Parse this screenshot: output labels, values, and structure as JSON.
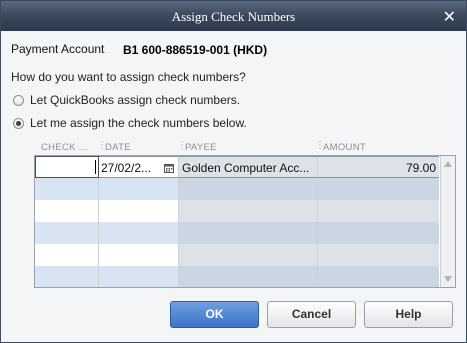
{
  "window": {
    "title": "Assign Check Numbers",
    "close_glyph": "✕"
  },
  "payment_account": {
    "label": "Payment Account",
    "value": "B1 600-886519-001 (HKD)"
  },
  "question": "How do you want to assign check numbers?",
  "options": [
    {
      "label": "Let QuickBooks assign check numbers.",
      "checked": false
    },
    {
      "label": "Let me assign the check numbers below.",
      "checked": true
    }
  ],
  "table": {
    "columns": [
      "CHECK ...",
      "DATE",
      "PAYEE",
      "AMOUNT"
    ],
    "column_sep": "⋮",
    "rows": [
      {
        "check": "",
        "date": "27/02/2...",
        "payee": "Golden Computer Acc...",
        "amount": "79.00"
      }
    ],
    "empty_rows": 5
  },
  "buttons": {
    "ok": "OK",
    "cancel": "Cancel",
    "help": "Help"
  },
  "colors": {
    "titlebar": "#3d4a5e",
    "ok_button": "#3c72c9",
    "row_alt": "#d9e4f3"
  },
  "icons": {
    "close": "close-icon",
    "calendar": "calendar-icon",
    "scroll_up": "scroll-up-icon",
    "scroll_down": "scroll-down-icon"
  }
}
